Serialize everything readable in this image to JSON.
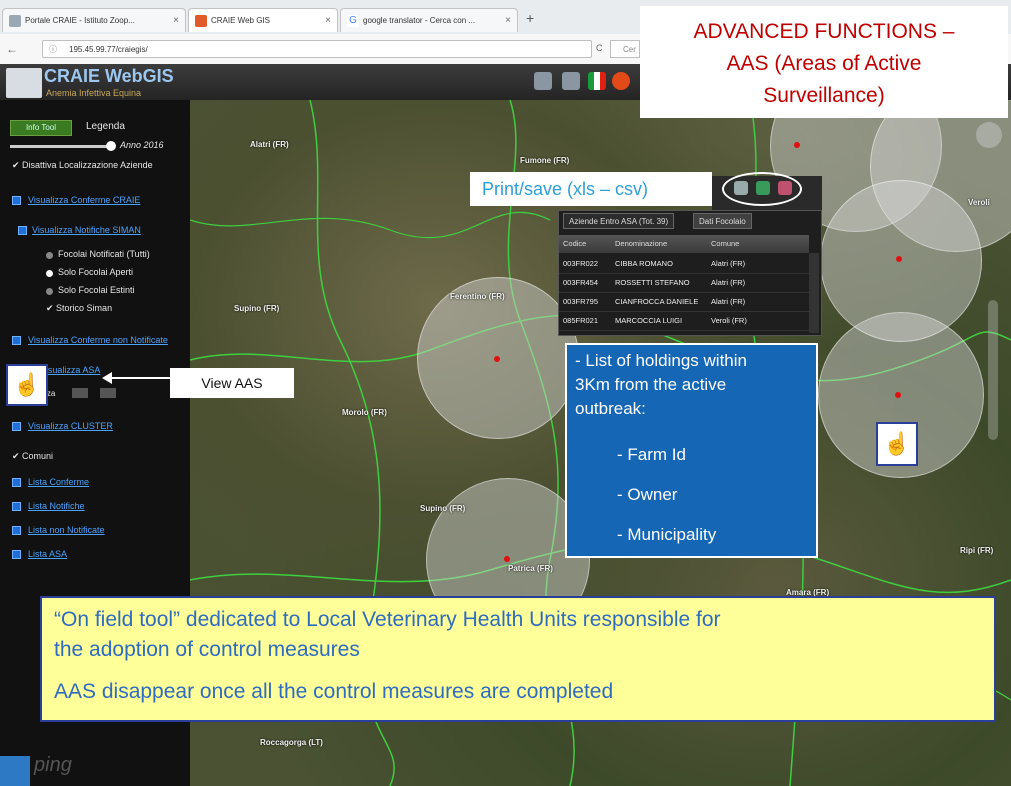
{
  "browser": {
    "tabs": [
      {
        "label": "Portale CRAIE - Istituto Zoop...",
        "close": "×"
      },
      {
        "label": "CRAIE Web GIS",
        "close": "×"
      },
      {
        "label": "google translator - Cerca con ...",
        "close": "×"
      }
    ],
    "new_tab": "+",
    "url": "195.45.99.77/craiegis/",
    "reload": "C",
    "search_placeholder": "Cer"
  },
  "app": {
    "title": "CRAIE WebGIS",
    "subtitle": "Anemia Infettiva Equina"
  },
  "sidebar": {
    "tab_active": "Info Tool",
    "tab_legend": "Legenda",
    "year_label": "Anno 2016",
    "disable_localization": "Disattiva Localizzazione Aziende",
    "links": {
      "conferme": "Visualizza Conferme CRAIE",
      "notifiche": "Visualizza Notifiche SIMAN",
      "conferme_non_notificate": "Visualizza Conferme non Notificate",
      "asa": "Visualizza ASA",
      "cluster": "Visualizza CLUSTER",
      "lista_conferme": "Lista Conferme",
      "lista_notifiche": "Lista Notifiche",
      "lista_non_notificate": "Lista non Notificate",
      "lista_asa": "Lista ASA"
    },
    "radio_all": "Focolai Notificati (Tutti)",
    "radio_open": "Solo Focolai Aperti",
    "radio_closed": "Solo Focolai Estinti",
    "check_storico": "Storico Siman",
    "distance_label": "enza",
    "check_comuni": "Comuni"
  },
  "map": {
    "labels": {
      "fumone": "Fumone (FR)",
      "alatri_top": "Alatri (FR)",
      "supino_left": "Supino (FR)",
      "ferentino": "Ferentino (FR)",
      "morolo": "Morolo (FR)",
      "supino": "Supino (FR)",
      "patrica": "Patrica (FR)",
      "amara": "Amara (FR)",
      "ripi": "Ripi (FR)",
      "roccagorga": "Roccagorga (LT)",
      "veroli": "Veroli"
    }
  },
  "annotations": {
    "title_lines": [
      "ADVANCED FUNCTIONS –",
      "AAS (Areas of Active",
      "Surveillance)"
    ],
    "print_save": "Print/save (xls – csv)",
    "view_aas": "View AAS",
    "list_lines": [
      "- List of holdings within",
      "3Km from the active",
      "outbreak:"
    ],
    "list_items": [
      "- Farm Id",
      "- Owner",
      "- Municipality"
    ],
    "yellow_lines": [
      "“On field tool” dedicated to Local Veterinary Health Units responsible for",
      "the adoption of control measures",
      "AAS disappear once all the control measures are completed"
    ]
  },
  "panel": {
    "tab_aziende": "Aziende Entro ASA (Tot. 39)",
    "tab_focolaio": "Dati Focolaio",
    "headers": {
      "codice": "Codice",
      "denominazione": "Denominazione",
      "comune": "Comune"
    },
    "rows": [
      {
        "codice": "003FR022",
        "denominazione": "CIBBA ROMANO",
        "comune": "Alatri (FR)"
      },
      {
        "codice": "003FR454",
        "denominazione": "ROSSETTI STEFANO",
        "comune": "Alatri (FR)"
      },
      {
        "codice": "003FR795",
        "denominazione": "CIANFROCCA DANIELE",
        "comune": "Alatri (FR)"
      },
      {
        "codice": "085FR021",
        "denominazione": "MARCOCCIA LUIGI",
        "comune": "Veroli (FR)"
      }
    ]
  },
  "watermark": "ping"
}
